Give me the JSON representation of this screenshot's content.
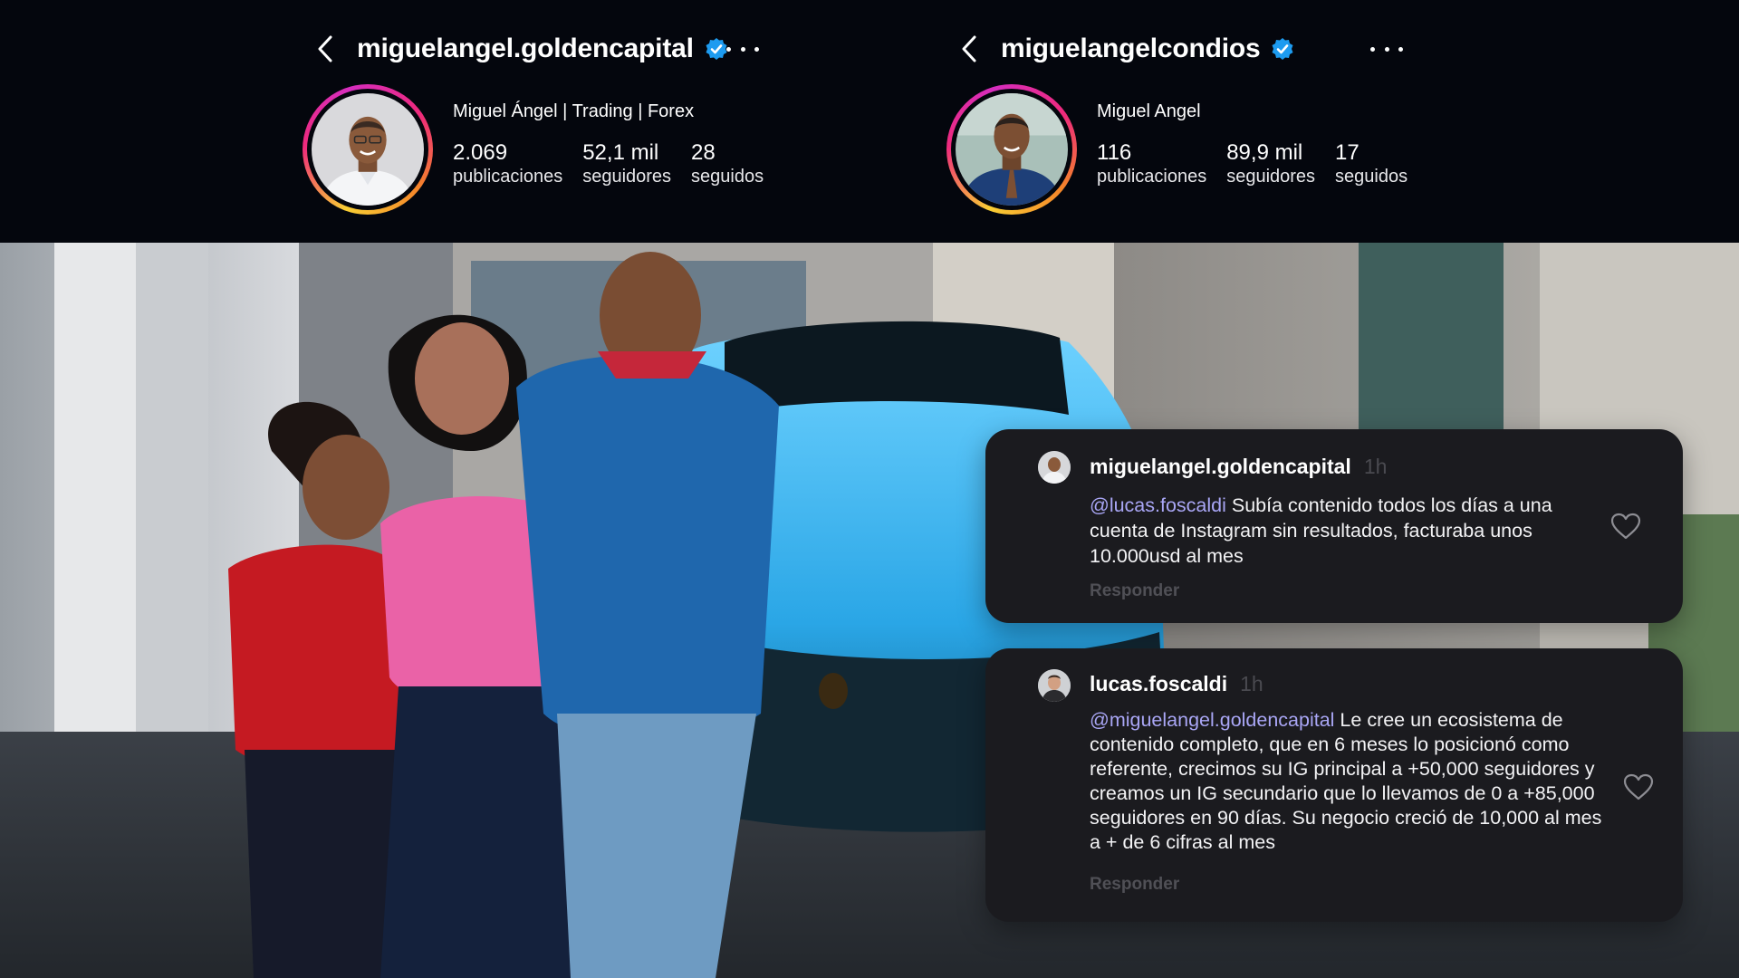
{
  "profiles": [
    {
      "username": "miguelangel.goldencapital",
      "verified": true,
      "display_name": "Miguel Ángel | Trading | Forex",
      "stats": [
        {
          "value": "2.069",
          "label": "publicaciones"
        },
        {
          "value": "52,1 mil",
          "label": "seguidores"
        },
        {
          "value": "28",
          "label": "seguidos"
        }
      ],
      "icons": {
        "back": "chevron-left-icon",
        "badge": "verified-badge-icon",
        "more": "more-horizontal-icon"
      }
    },
    {
      "username": "miguelangelcondios",
      "verified": true,
      "display_name": "Miguel Angel",
      "stats": [
        {
          "value": "116",
          "label": "publicaciones"
        },
        {
          "value": "89,9 mil",
          "label": "seguidores"
        },
        {
          "value": "17",
          "label": "seguidos"
        }
      ],
      "icons": {
        "back": "chevron-left-icon",
        "badge": "verified-badge-icon",
        "more": "more-horizontal-icon"
      }
    }
  ],
  "comments": [
    {
      "user": "miguelangel.goldencapital",
      "time": "1h",
      "mention": "@lucas.foscaldi",
      "text": " Subía contenido todos los días a una cuenta de Instagram sin resultados, facturaba unos 10.000usd al mes",
      "reply_label": "Responder"
    },
    {
      "user": "lucas.foscaldi",
      "time": "1h",
      "mention": "@miguelangel.goldencapital",
      "text": " Le cree un ecosistema de contenido completo, que en 6 meses lo posicionó como referente, crecimos su IG principal a +50,000 seguidores y creamos un IG secundario que lo llevamos de 0 a +85,000 seguidores en 90 días. Su negocio creció de 10,000 al mes a + de 6 cifras al mes",
      "reply_label": "Responder"
    }
  ],
  "colors": {
    "background": "#04060d",
    "card": "#1b1b1f",
    "mention": "#a9a6f5",
    "verified": "#1d9bf0",
    "muted": "#505056"
  }
}
